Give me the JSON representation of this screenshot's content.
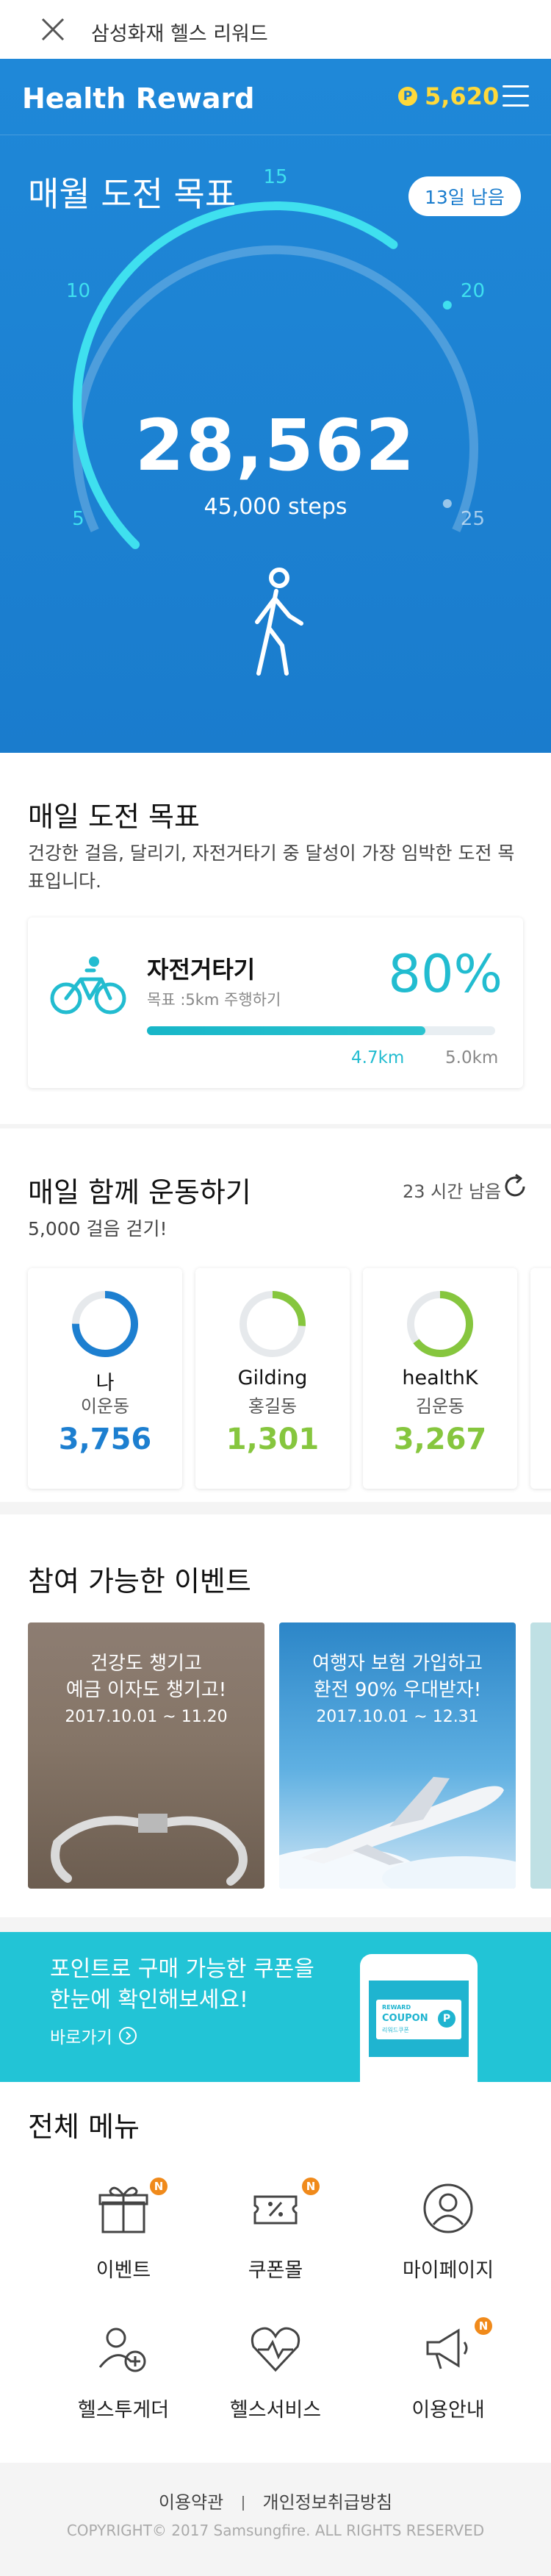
{
  "topbar": {
    "title": "삼성화재 헬스 리워드"
  },
  "header": {
    "brand": "Health Reward",
    "points": "5,620",
    "coin_glyph": "P"
  },
  "monthly": {
    "title": "매월 도전 목표",
    "days_left": "13일 남음",
    "steps": "28,562",
    "goal": "45,000 steps",
    "scale_labels": [
      "5",
      "10",
      "15",
      "20",
      "25"
    ],
    "progress_fraction": 0.635
  },
  "daily_goal": {
    "title": "매일 도전 목표",
    "desc": "건강한 걸음, 달리기, 자전거타기 중 달성이 가장 임박한 도전 목표입니다.",
    "activity": "자전거타기",
    "target": "목표 :5km 주행하기",
    "percent": "80%",
    "progress_fraction": 0.8,
    "current": "4.7km",
    "max": "5.0km"
  },
  "together": {
    "title": "매일 함께 운동하기",
    "time_left": "23 시간 남음",
    "desc": "5,000 걸음 걷기!",
    "friends": [
      {
        "name": "나",
        "sub": "이운동",
        "steps": "3,756",
        "color": "#1d7fd0",
        "fraction": 0.75
      },
      {
        "name": "Gilding",
        "sub": "홍길동",
        "steps": "1,301",
        "color": "#86c63e",
        "fraction": 0.26
      },
      {
        "name": "healthK",
        "sub": "김운동",
        "steps": "3,267",
        "color": "#86c63e",
        "fraction": 0.65
      }
    ]
  },
  "events": {
    "title": "참여 가능한 이벤트",
    "items": [
      {
        "line1": "건강도 챙기고",
        "line2": "예금 이자도 챙기고!",
        "date": "2017.10.01 ~ 11.20"
      },
      {
        "line1": "여행자 보험 가입하고",
        "line2": "환전 90% 우대받자!",
        "date": "2017.10.01 ~ 12.31"
      }
    ]
  },
  "banner": {
    "line1": "포인트로 구매 가능한 쿠폰을",
    "line2": "한눈에 확인해보세요!",
    "link": "바로가기",
    "phone_text1": "REWARD",
    "phone_text2": "COUPON",
    "phone_text3": "리워드쿠폰"
  },
  "menu": {
    "title": "전체 메뉴",
    "badge": "N",
    "items": [
      {
        "label": "이벤트"
      },
      {
        "label": "쿠폰몰"
      },
      {
        "label": "마이페이지"
      },
      {
        "label": "헬스투게더"
      },
      {
        "label": "헬스서비스"
      },
      {
        "label": "이용안내"
      }
    ]
  },
  "footer": {
    "terms": "이용약관",
    "privacy": "개인정보취급방침",
    "copyright": "COPYRIGHT© 2017 Samsungfire.  ALL RIGHTS RESERVED"
  }
}
